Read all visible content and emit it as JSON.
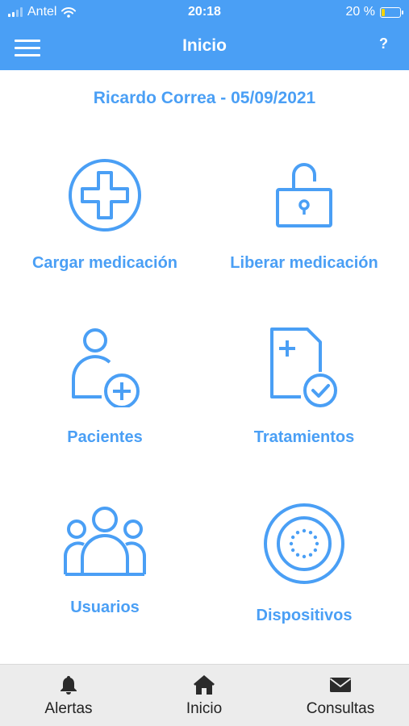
{
  "status_bar": {
    "carrier": "Antel",
    "time": "20:18",
    "battery_percent_label": "20 %",
    "battery_level": 0.2
  },
  "nav": {
    "title": "Inicio",
    "help_label": "?",
    "menu_icon": "hamburger-menu-icon"
  },
  "user_line": "Ricardo Correa - 05/09/2021",
  "tiles": [
    {
      "label": "Cargar medicación",
      "icon": "plus-circle-icon"
    },
    {
      "label": "Liberar medicación",
      "icon": "unlock-icon"
    },
    {
      "label": "Pacientes",
      "icon": "add-user-icon"
    },
    {
      "label": "Tratamientos",
      "icon": "document-check-icon"
    },
    {
      "label": "Usuarios",
      "icon": "users-group-icon"
    },
    {
      "label": "Dispositivos",
      "icon": "device-dial-icon"
    }
  ],
  "tab_bar": {
    "items": [
      {
        "label": "Alertas",
        "icon": "bell-icon"
      },
      {
        "label": "Inicio",
        "icon": "home-icon"
      },
      {
        "label": "Consultas",
        "icon": "envelope-icon"
      }
    ]
  },
  "colors": {
    "accent": "#4a9ff5",
    "tab_bar_bg": "#ececec",
    "battery_fill": "#f5d300"
  }
}
